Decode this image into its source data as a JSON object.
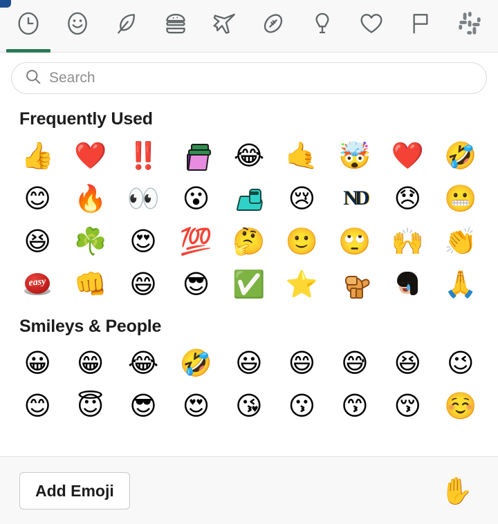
{
  "theme": {
    "accent": "#2b7a57",
    "background": "#ffffff",
    "chrome_background": "#f8f8f8",
    "border": "#e2e2e2",
    "text": "#1d1c1d",
    "placeholder_text": "#8d8d8d"
  },
  "tabs": [
    {
      "name": "frequently-used",
      "icon": "clock-icon",
      "active": true
    },
    {
      "name": "smileys-people",
      "icon": "smiley-icon",
      "active": false
    },
    {
      "name": "nature",
      "icon": "leaf-icon",
      "active": false
    },
    {
      "name": "food-drink",
      "icon": "burger-icon",
      "active": false
    },
    {
      "name": "travel-places",
      "icon": "airplane-icon",
      "active": false
    },
    {
      "name": "activities",
      "icon": "football-icon",
      "active": false
    },
    {
      "name": "objects",
      "icon": "lightbulb-icon",
      "active": false
    },
    {
      "name": "symbols",
      "icon": "heart-icon",
      "active": false
    },
    {
      "name": "flags",
      "icon": "flag-icon",
      "active": false
    },
    {
      "name": "custom",
      "icon": "slack-logo-icon",
      "active": false
    }
  ],
  "search": {
    "placeholder": "Search",
    "value": "",
    "icon": "search-icon"
  },
  "sections": [
    {
      "title": "Frequently Used",
      "rows": [
        [
          {
            "glyph": "👍",
            "name": "thumbsup",
            "custom": null
          },
          {
            "glyph": "❤️",
            "name": "heart",
            "custom": null
          },
          {
            "glyph": "‼️",
            "name": "bangbang",
            "custom": null
          },
          {
            "glyph": "",
            "name": "custom-purple-hat-figure",
            "custom": "phan"
          },
          {
            "glyph": "😂",
            "name": "joy",
            "custom": null
          },
          {
            "glyph": "🤙",
            "name": "call-me-hand",
            "custom": null
          },
          {
            "glyph": "🤯",
            "name": "exploding-head",
            "custom": null
          },
          {
            "glyph": "❤️",
            "name": "dark-red-heart",
            "custom": null
          },
          {
            "glyph": "🤣",
            "name": "rolling-on-the-floor-laughing",
            "custom": null
          }
        ],
        [
          {
            "glyph": "😊",
            "name": "blush",
            "custom": null
          },
          {
            "glyph": "🔥",
            "name": "fire",
            "custom": null
          },
          {
            "glyph": "👀",
            "name": "eyes",
            "custom": null
          },
          {
            "glyph": "😮",
            "name": "open-mouth",
            "custom": null
          },
          {
            "glyph": "",
            "name": "custom-teal-creature",
            "custom": "teal"
          },
          {
            "glyph": "😢",
            "name": "cry",
            "custom": null
          },
          {
            "glyph": "",
            "name": "custom-notre-dame-logo",
            "custom": "nd"
          },
          {
            "glyph": "😞",
            "name": "disappointed",
            "custom": null
          },
          {
            "glyph": "😬",
            "name": "grimacing",
            "custom": null
          }
        ],
        [
          {
            "glyph": "😆",
            "name": "laughing",
            "custom": null
          },
          {
            "glyph": "☘️",
            "name": "shamrock",
            "custom": null
          },
          {
            "glyph": "😍",
            "name": "heart-eyes",
            "custom": null
          },
          {
            "glyph": "💯",
            "name": "hundred-points",
            "custom": null
          },
          {
            "glyph": "🤔",
            "name": "thinking-face",
            "custom": null
          },
          {
            "glyph": "🙂",
            "name": "slightly-smiling-face",
            "custom": null
          },
          {
            "glyph": "🙄",
            "name": "roll-eyes",
            "custom": null
          },
          {
            "glyph": "🙌",
            "name": "raised-hands",
            "custom": null
          },
          {
            "glyph": "👏",
            "name": "clap",
            "custom": null
          }
        ],
        [
          {
            "glyph": "",
            "name": "custom-easy-button",
            "custom": "easy",
            "label": "easy"
          },
          {
            "glyph": "👊",
            "name": "fist-bump",
            "custom": null
          },
          {
            "glyph": "😄",
            "name": "smile",
            "custom": null
          },
          {
            "glyph": "😎",
            "name": "sunglasses",
            "custom": null
          },
          {
            "glyph": "✅",
            "name": "white-check-mark",
            "custom": null
          },
          {
            "glyph": "⭐",
            "name": "star",
            "custom": null
          },
          {
            "glyph": "",
            "name": "custom-dancing-dino",
            "custom": "dino"
          },
          {
            "glyph": "",
            "name": "custom-crying-woman",
            "custom": "kim"
          },
          {
            "glyph": "🙏",
            "name": "pray",
            "custom": null
          }
        ]
      ]
    },
    {
      "title": "Smileys & People",
      "rows": [
        [
          {
            "glyph": "😀",
            "name": "grinning",
            "custom": null
          },
          {
            "glyph": "😁",
            "name": "grin",
            "custom": null
          },
          {
            "glyph": "😂",
            "name": "joy",
            "custom": null
          },
          {
            "glyph": "🤣",
            "name": "rolling-on-the-floor-laughing",
            "custom": null
          },
          {
            "glyph": "😃",
            "name": "smiley",
            "custom": null
          },
          {
            "glyph": "😄",
            "name": "smile",
            "custom": null
          },
          {
            "glyph": "😅",
            "name": "sweat-smile",
            "custom": null
          },
          {
            "glyph": "😆",
            "name": "laughing",
            "custom": null
          },
          {
            "glyph": "😉",
            "name": "wink",
            "custom": null
          }
        ],
        [
          {
            "glyph": "😊",
            "name": "blush",
            "custom": null
          },
          {
            "glyph": "😇",
            "name": "innocent",
            "custom": null
          },
          {
            "glyph": "😎",
            "name": "sunglasses",
            "custom": null
          },
          {
            "glyph": "😍",
            "name": "heart-eyes",
            "custom": null
          },
          {
            "glyph": "😘",
            "name": "kissing-heart",
            "custom": null
          },
          {
            "glyph": "😗",
            "name": "kissing",
            "custom": null
          },
          {
            "glyph": "😙",
            "name": "kissing-smiling-eyes",
            "custom": null
          },
          {
            "glyph": "😚",
            "name": "kissing-closed-eyes",
            "custom": null
          },
          {
            "glyph": "☺️",
            "name": "relaxed",
            "custom": null
          }
        ]
      ]
    }
  ],
  "footer": {
    "add_emoji_label": "Add Emoji",
    "skin_tone_glyph": "✋",
    "skin_tone_name": "raised-hand"
  }
}
